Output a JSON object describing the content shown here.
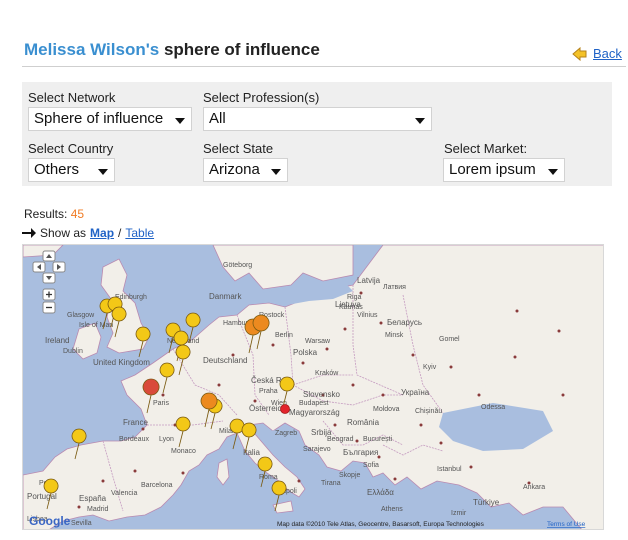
{
  "header": {
    "name": "Melissa Wilson's",
    "title_rest": "sphere of influence",
    "back_label": "Back"
  },
  "filters": {
    "network": {
      "label": "Select Network",
      "value": "Sphere of influence"
    },
    "profession": {
      "label": "Select Profession(s)",
      "value": "All"
    },
    "country": {
      "label": "Select Country",
      "value": "Others"
    },
    "state": {
      "label": "Select State",
      "value": "Arizona"
    },
    "market": {
      "label": "Select Market:",
      "value": "Lorem ipsum"
    }
  },
  "results": {
    "label": "Results:",
    "count": "45"
  },
  "show_as": {
    "label": "Show as",
    "map_link": "Map",
    "separator": "/",
    "table_link": "Table"
  },
  "map": {
    "attribution": "Map data ©2010 Tele Atlas, Geocentre, Basarsoft, Europa Technologies",
    "terms": "Terms of Use",
    "google_logo": "Google",
    "controls": [
      "pan-up",
      "pan-left",
      "pan-right",
      "pan-down",
      "zoom-in",
      "zoom-out"
    ],
    "labels": [
      {
        "text": "Edinburgh"
      },
      {
        "text": "Göteborg"
      },
      {
        "text": "Riga"
      },
      {
        "text": "Latvija"
      },
      {
        "text": "Lietuva"
      },
      {
        "text": "Danmark"
      },
      {
        "text": "Isle of Man"
      },
      {
        "text": "Ireland"
      },
      {
        "text": "Dublin"
      },
      {
        "text": "Vilnius"
      },
      {
        "text": "Беларусь"
      },
      {
        "text": "Minsk"
      },
      {
        "text": "United Kingdom"
      },
      {
        "text": "Nederland"
      },
      {
        "text": "Hamburg"
      },
      {
        "text": "Berlin"
      },
      {
        "text": "Deutschland"
      },
      {
        "text": "Polska"
      },
      {
        "text": "Warsaw"
      },
      {
        "text": "Česká Rep."
      },
      {
        "text": "Україна"
      },
      {
        "text": "Kyiv"
      },
      {
        "text": "Slovensko"
      },
      {
        "text": "Österreich"
      },
      {
        "text": "Magyarország"
      },
      {
        "text": "Moldova"
      },
      {
        "text": "France"
      },
      {
        "text": "Paris"
      },
      {
        "text": "România"
      },
      {
        "text": "București"
      },
      {
        "text": "Srbija"
      },
      {
        "text": "България"
      },
      {
        "text": "Italia"
      },
      {
        "text": "Roma"
      },
      {
        "text": "España"
      },
      {
        "text": "Madrid"
      },
      {
        "text": "Portugal"
      },
      {
        "text": "Lisboa"
      },
      {
        "text": "Türkiye"
      },
      {
        "text": "Ελλάδα"
      },
      {
        "text": "Athens"
      },
      {
        "text": "Istanbul"
      },
      {
        "text": "Ankara"
      },
      {
        "text": "Monaco"
      },
      {
        "text": "Glasgow"
      },
      {
        "text": "Rostock"
      },
      {
        "text": "Lyon"
      },
      {
        "text": "Bordeaux"
      },
      {
        "text": "Milano"
      },
      {
        "text": "Napoli"
      },
      {
        "text": "Barcelona"
      },
      {
        "text": "Porto"
      },
      {
        "text": "Sevilla"
      },
      {
        "text": "Valencia"
      },
      {
        "text": "Kaunas"
      },
      {
        "text": "Латвия"
      },
      {
        "text": "Gomel"
      },
      {
        "text": "Odessa"
      },
      {
        "text": "Chișinău"
      },
      {
        "text": "Budapest"
      },
      {
        "text": "Wien"
      },
      {
        "text": "Praha"
      },
      {
        "text": "Kraków"
      },
      {
        "text": "Zagreb"
      },
      {
        "text": "Sarajevo"
      },
      {
        "text": "Beograd"
      },
      {
        "text": "Sofia"
      },
      {
        "text": "Skopje"
      },
      {
        "text": "Tirana"
      },
      {
        "text": "Izmir"
      }
    ],
    "colors": {
      "sea": "#a9bedf",
      "land": "#f2efe9",
      "border": "#b98ab0",
      "yellow": "#f3c817",
      "orange": "#ec8a1f",
      "red": "#d94a3a",
      "dot": "#e3232b"
    }
  }
}
